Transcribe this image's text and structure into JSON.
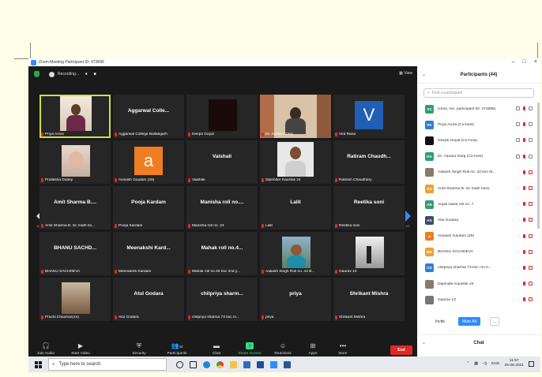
{
  "window": {
    "title": "Zoom Meeting Participant ID: 473695",
    "controls": [
      "–",
      "□",
      "×"
    ]
  },
  "topbar": {
    "recording_label": "Recording...",
    "pause_label": "⏸",
    "stop_label": "■",
    "view_label": "View"
  },
  "tiles": [
    {
      "name": "",
      "label": "Priya Arora",
      "type": "photo",
      "active": true,
      "bg": "#4a4234"
    },
    {
      "name": "Aggarwal Colle...",
      "label": "Aggarwal College Ballabgarh",
      "type": "name"
    },
    {
      "name": "",
      "label": "Deepti Goyal",
      "type": "dark"
    },
    {
      "name": "",
      "label": "Dr. Arpana Garg",
      "type": "photo2"
    },
    {
      "name": "",
      "label": "Ved Rana",
      "type": "letter",
      "letter": "V",
      "color": "#1f5fb5"
    },
    {
      "name": "",
      "label": "Pratiksha Dubey",
      "type": "baby"
    },
    {
      "name": "",
      "label": "Avinash Gautam (29)",
      "type": "letter",
      "letter": "a",
      "color": "#f07d22"
    },
    {
      "name": "Vaishali",
      "label": "Vaishali",
      "type": "name"
    },
    {
      "name": "",
      "label": "Dipender Kaushik 24",
      "type": "man"
    },
    {
      "name": "Ratiram Chaudh...",
      "label": "Ratiram Chaudhary",
      "type": "name"
    },
    {
      "name": "Amit Sharma B....",
      "label": "Amit Sharma B. Sc math ho...",
      "type": "name"
    },
    {
      "name": "Pooja Kardam",
      "label": "Pooja Kardam",
      "type": "name"
    },
    {
      "name": "Manisha roll no....",
      "label": "Manisha roll no. 24",
      "type": "name"
    },
    {
      "name": "Lalit",
      "label": "Lalit",
      "type": "name"
    },
    {
      "name": "Reetika soni",
      "label": "Reetika soni",
      "type": "name"
    },
    {
      "name": "BHANU SACHD...",
      "label": "BHANU SACHDEVA",
      "type": "name"
    },
    {
      "name": "Meenakshi Kard...",
      "label": "Meenakshi Kardam",
      "type": "name"
    },
    {
      "name": "Mahak roll no.4...",
      "label": "Mahak roll no.40 bsc 2nd y...",
      "type": "name"
    },
    {
      "name": "",
      "label": "Aakash Singh Roll no. 42 B...",
      "type": "man2"
    },
    {
      "name": "",
      "label": "Gaurav 13",
      "type": "street"
    },
    {
      "name": "",
      "label": "Prachi Chauhan(14)",
      "type": "room"
    },
    {
      "name": "Atul Godara",
      "label": "Atul Godara",
      "type": "name"
    },
    {
      "name": "chitpriya sharm...",
      "label": "chitpriya sharma 73 bsc m...",
      "type": "name"
    },
    {
      "name": "priya",
      "label": "priya",
      "type": "name"
    },
    {
      "name": "Shrikant Mishra",
      "label": "Shrikant Mishra",
      "type": "name"
    }
  ],
  "pages": {
    "left": "1/2",
    "right": "1/2"
  },
  "toolbar": {
    "join_audio": "Join Audio",
    "start_video": "Start Video",
    "security": "Security",
    "participants": "Participants",
    "participants_count": "44",
    "chat": "Chat",
    "share_screen": "Share Screen",
    "reactions": "Reactions",
    "apps": "Apps",
    "more": "More",
    "end": "End"
  },
  "panel": {
    "title": "Participants (44)",
    "search_placeholder": "Find a participant",
    "participants": [
      {
        "initials": "AC",
        "color": "#2f9e72",
        "name": "(Host, me, participant ID: 473695)"
      },
      {
        "initials": "PA",
        "color": "#2d7fd3",
        "name": "Priya Arora (Co-host)"
      },
      {
        "initials": "",
        "color": "#111111",
        "name": "Deepti Goyal (Co-host)"
      },
      {
        "initials": "DA",
        "color": "#2f9e72",
        "name": "Dr. Arpana Garg (Co-host)"
      },
      {
        "initials": "",
        "color": "#8a7b68",
        "name": "Aakash Singh Roll no. 42 bsc M..."
      },
      {
        "initials": "AS",
        "color": "#f0a030",
        "name": "Amit Sharma B. Sc math hons."
      },
      {
        "initials": "AR",
        "color": "#2f9e72",
        "name": "Anjali rawat roll no. 7"
      },
      {
        "initials": "AG",
        "color": "#3a4a6b",
        "name": "Atul Godara"
      },
      {
        "initials": "a",
        "color": "#f07d22",
        "name": "Avinash Gautam (29)"
      },
      {
        "initials": "BS",
        "color": "#f0a030",
        "name": "BHANU SACHDEVA"
      },
      {
        "initials": "CS",
        "color": "#2d7fd3",
        "name": "chitpriya sharma 73 bsc nm tr..."
      },
      {
        "initials": "",
        "color": "#8a7b68",
        "name": "Dipender Kaushik 24"
      },
      {
        "initials": "",
        "color": "#777777",
        "name": "Gaurav 13"
      }
    ],
    "invite": "Invite",
    "mute_all": "Mute All",
    "more": "...",
    "chat_title": "Chat"
  },
  "taskbar": {
    "search_placeholder": "Type here to search",
    "language": "ENG",
    "time": "11:57",
    "date": "26-06-2021"
  }
}
